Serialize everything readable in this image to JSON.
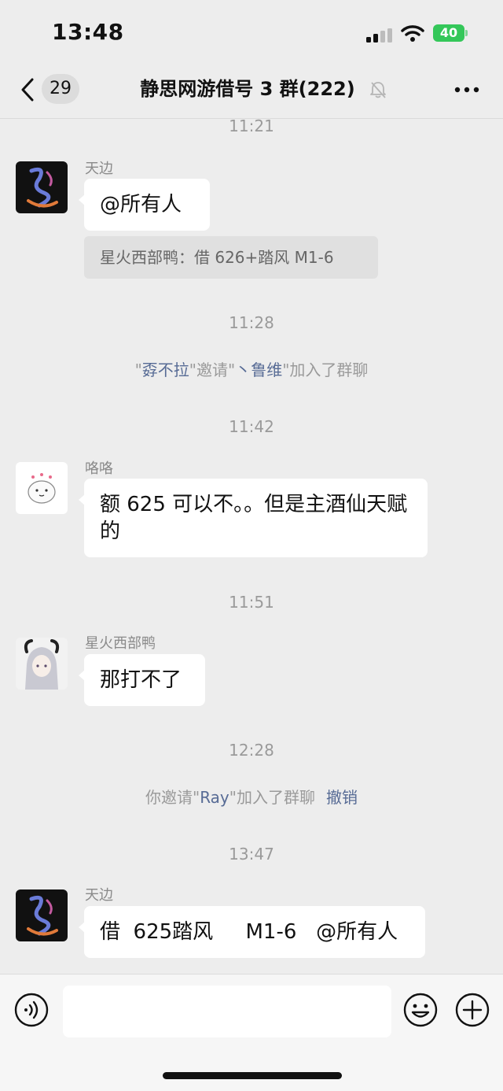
{
  "status_bar": {
    "time": "13:48",
    "battery": "40"
  },
  "nav": {
    "unread_count": "29",
    "title": "静思网游借号 3 群(222)"
  },
  "messages": [
    {
      "timestamp": "11:21"
    },
    {
      "sender": "天边",
      "text": "@所有人",
      "quote": "星火西部鸭：借 626+踏风 M1-6"
    },
    {
      "timestamp": "11:28"
    },
    {
      "system": {
        "q1": "\"",
        "inviter": "孬不拉",
        "mid": "\"邀请\"",
        "invitee": "丶鲁维",
        "end": "\"加入了群聊"
      }
    },
    {
      "timestamp": "11:42"
    },
    {
      "sender": "咯咯",
      "text": "额  625 可以不。。但是主酒仙天赋的"
    },
    {
      "timestamp": "11:51"
    },
    {
      "sender": "星火西部鸭",
      "text": "那打不了"
    },
    {
      "timestamp": "12:28"
    },
    {
      "system": {
        "prefix": "你邀请\"",
        "invitee": "Ray",
        "end": "\"加入了群聊",
        "action": "撤销"
      }
    },
    {
      "timestamp": "13:47"
    },
    {
      "sender": "天边",
      "text": "借  625踏风     M1-6   @所有人"
    }
  ],
  "colors": {
    "background": "#ededed",
    "bubble": "#ffffff",
    "link": "#576b95",
    "battery": "#34c759"
  },
  "icons": [
    "back-icon",
    "mute-bell-icon",
    "more-icon",
    "voice-icon",
    "emoji-icon",
    "add-icon"
  ]
}
